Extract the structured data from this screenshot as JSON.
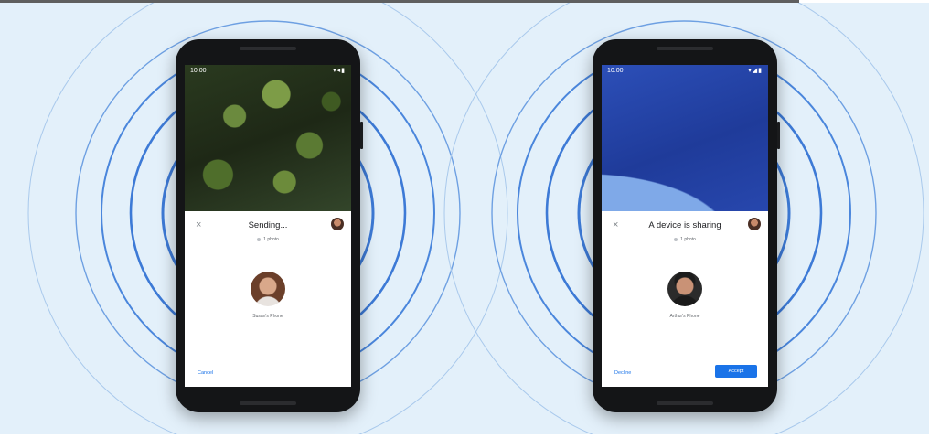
{
  "colors": {
    "background": "#e3f0fa",
    "ring": "#3d7ad6",
    "ring_faint": "#9fc3ea",
    "accent": "#1a73e8"
  },
  "phones": [
    {
      "status_time": "10:00",
      "status_icons": "▾◂▮",
      "close_icon": "×",
      "title": "Sending...",
      "chip": "1 photo",
      "device_name": "Susan's Phone",
      "primary_action": "",
      "secondary_action": "Cancel"
    },
    {
      "status_time": "10:00",
      "status_icons": "▾◢▮",
      "close_icon": "×",
      "title": "A device is sharing",
      "chip": "1 photo",
      "device_name": "Arthur's Phone",
      "primary_action": "Accept",
      "secondary_action": "Decline"
    }
  ]
}
